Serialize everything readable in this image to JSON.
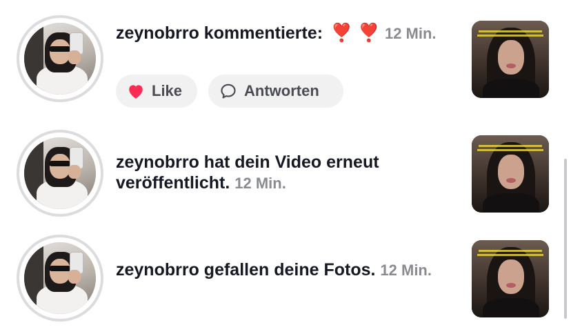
{
  "notifications": [
    {
      "username": "zeynobrro",
      "action": " kommentierte: ",
      "emoji": "❣️ ❣️",
      "time": "12 Min.",
      "actions": {
        "like_label": "Like",
        "reply_label": "Antworten"
      }
    },
    {
      "username": "zeynobrro",
      "action": " hat dein Video erneut veröffentlicht.",
      "time": "12 Min."
    },
    {
      "username": "zeynobrro",
      "action": " gefallen deine Fotos.",
      "time": "12 Min."
    }
  ],
  "colors": {
    "like_heart": "#fe2c55",
    "secondary_text": "#8a8b91",
    "pill_bg": "#f1f1f2"
  },
  "icons": {
    "like": "heart-icon",
    "reply": "speech-bubble-icon"
  }
}
